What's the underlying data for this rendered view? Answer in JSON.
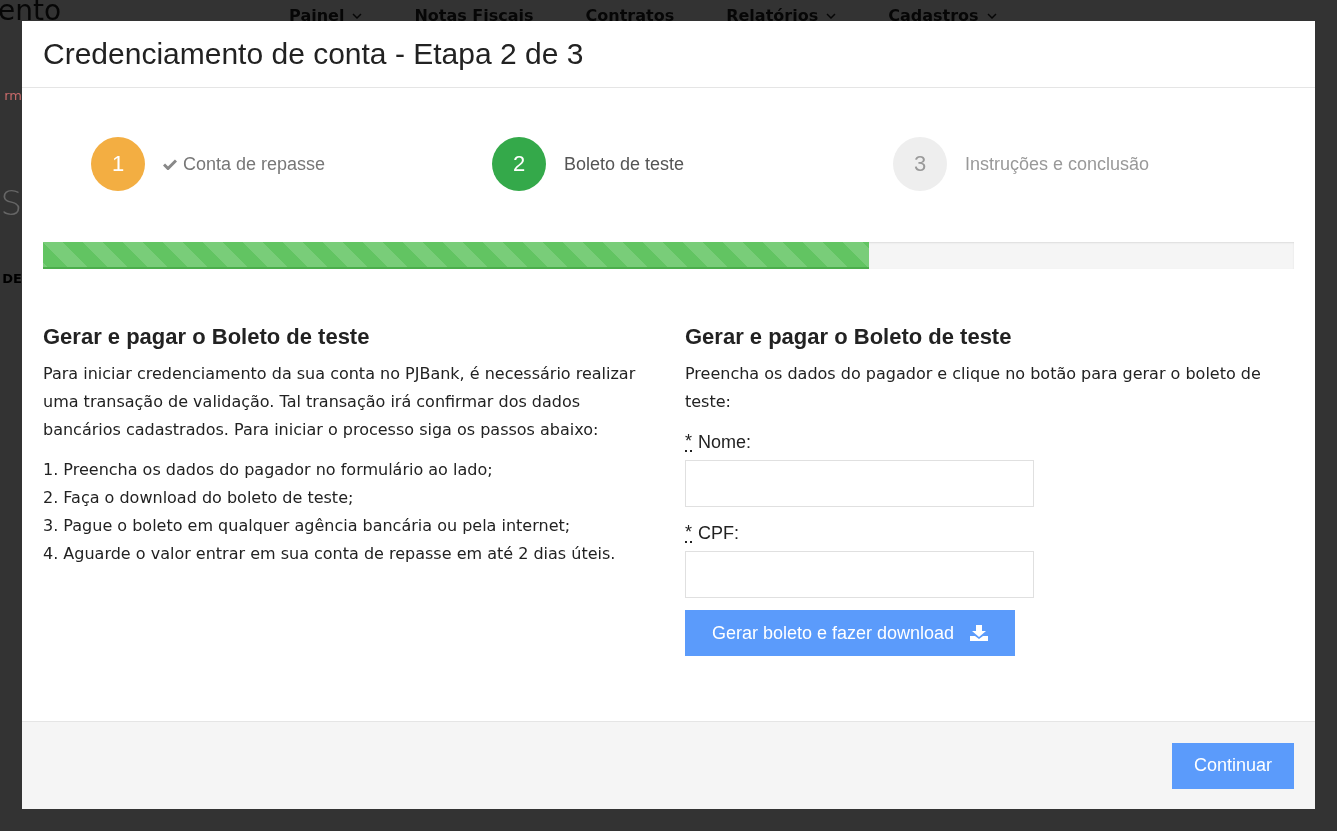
{
  "background": {
    "logo": "ento",
    "nav": [
      {
        "label": "Painel",
        "dropdown": true
      },
      {
        "label": "Notas Fiscais",
        "dropdown": false
      },
      {
        "label": "Contratos",
        "dropdown": false
      },
      {
        "label": "Relatórios",
        "dropdown": true
      },
      {
        "label": "Cadastros",
        "dropdown": true
      }
    ],
    "fragments": [
      {
        "kind": "link",
        "text": "rm"
      },
      {
        "kind": "title",
        "text": "S"
      },
      {
        "kind": "bold",
        "text": "DE"
      }
    ]
  },
  "modal": {
    "title": "Credenciamento de conta - Etapa 2 de 3",
    "steps": [
      {
        "number": "1",
        "label": "Conta de repasse",
        "completed": true,
        "selected": false
      },
      {
        "number": "2",
        "label": "Boleto de teste",
        "completed": false,
        "selected": true
      },
      {
        "number": "3",
        "label": "Instruções e conclusão",
        "completed": false,
        "selected": false
      }
    ],
    "progress": {
      "level": 0.66
    },
    "left": {
      "heading": "Gerar e pagar o Boleto de teste",
      "intro": "Para iniciar credenciamento da sua conta no PJBank, é necessário realizar uma transação de validação. Tal transação irá confirmar dos dados bancários cadastrados. Para iniciar o processo siga os passos abaixo:",
      "steps": [
        "1. Preencha os dados do pagador no formulário ao lado;",
        "2. Faça o download do boleto de teste;",
        "3. Pague o boleto em qualquer agência bancária ou pela internet;",
        "4. Aguarde o valor entrar em sua conta de repasse em até 2 dias úteis."
      ]
    },
    "right": {
      "heading": "Gerar e pagar o Boleto de teste",
      "intro": "Preencha os dados do pagador e clique no botão para gerar o boleto de teste:",
      "fields": [
        {
          "required_mark": "*",
          "label": "Nome:"
        },
        {
          "required_mark": "*",
          "label": "CPF:"
        }
      ],
      "button": "Gerar boleto e fazer download"
    },
    "footer": {
      "button": "Continuar"
    }
  }
}
